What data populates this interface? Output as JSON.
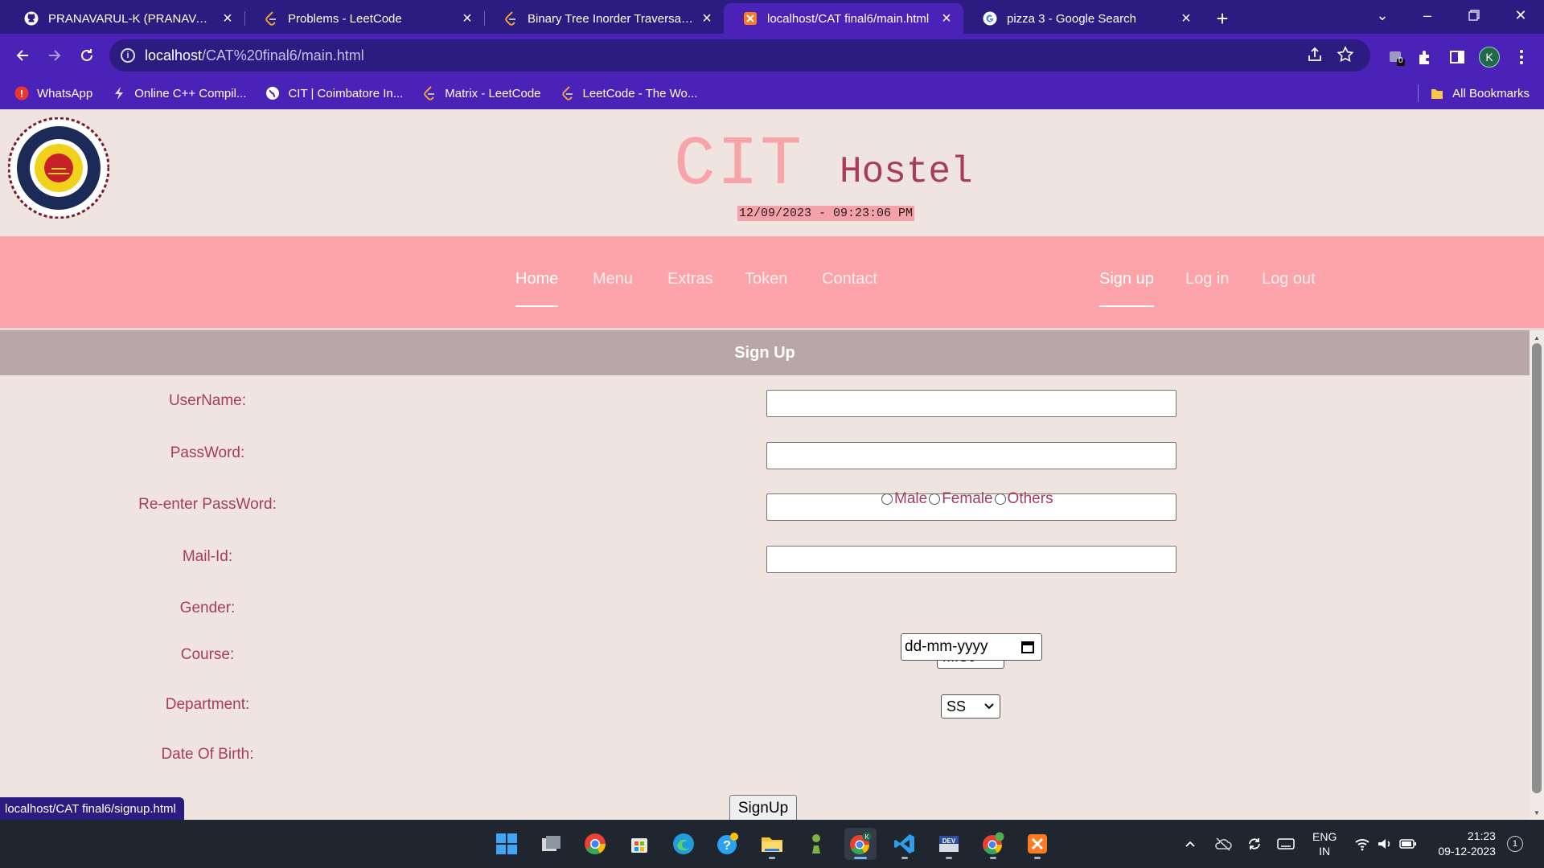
{
  "browser": {
    "tabs": [
      {
        "title": "PRANAVARUL-K (PRANAVARUL-K)",
        "icon": "github-icon",
        "active": false
      },
      {
        "title": "Problems - LeetCode",
        "icon": "leetcode-icon",
        "active": false
      },
      {
        "title": "Binary Tree Inorder Traversal - LeetCode",
        "icon": "leetcode-icon",
        "active": false
      },
      {
        "title": "localhost/CAT final6/main.html",
        "icon": "xampp-icon",
        "active": true
      },
      {
        "title": "pizza 3 - Google Search",
        "icon": "google-icon",
        "active": false
      }
    ],
    "url_host": "localhost",
    "url_path": "/CAT%20final6/main.html",
    "bookmarks": [
      {
        "label": "WhatsApp",
        "icon": "whatsapp-icon"
      },
      {
        "label": "Online C++ Compil...",
        "icon": "bolt-icon"
      },
      {
        "label": "CIT | Coimbatore In...",
        "icon": "globe-icon"
      },
      {
        "label": "Matrix - LeetCode",
        "icon": "leetcode-icon"
      },
      {
        "label": "LeetCode - The Wo...",
        "icon": "leetcode-icon"
      }
    ],
    "all_bookmarks": "All Bookmarks",
    "profile_initial": "K",
    "extension_badge": "0",
    "status_url": "localhost/CAT final6/signup.html"
  },
  "site": {
    "brand_main": "CIT",
    "brand_sub": "Hostel",
    "datetime": "12/09/2023 - 09:23:06 PM",
    "nav_left": [
      "Home",
      "Menu",
      "Extras",
      "Token",
      "Contact"
    ],
    "nav_right": [
      "Sign up",
      "Log in",
      "Log out"
    ],
    "active_nav": "Home",
    "active_nav_right": "Sign up"
  },
  "form": {
    "heading": "Sign Up",
    "username_label": "UserName:",
    "password_label": "PassWord:",
    "reenter_label": "Re-enter PassWord:",
    "mail_label": "Mail-Id:",
    "gender_label": "Gender:",
    "gender_options": [
      "Male",
      "Female",
      "Others"
    ],
    "course_label": "Course:",
    "course_value": "M.Sc",
    "department_label": "Department:",
    "department_value": "SS",
    "dob_label": "Date Of Birth:",
    "dob_placeholder": "dd-mm-yyyy",
    "submit_label": "SignUp"
  },
  "taskbar": {
    "lang_top": "ENG",
    "lang_bottom": "IN",
    "time": "21:23",
    "date": "09-12-2023",
    "notifications": "1"
  },
  "colors": {
    "chrome_dark": "#2c1b80",
    "chrome_light": "#4a22b7",
    "nav_pink": "#fda4aa",
    "brand_pink": "#f6a4a8",
    "label_maroon": "#a63d5a",
    "banner_grey": "#b9a6a8"
  }
}
